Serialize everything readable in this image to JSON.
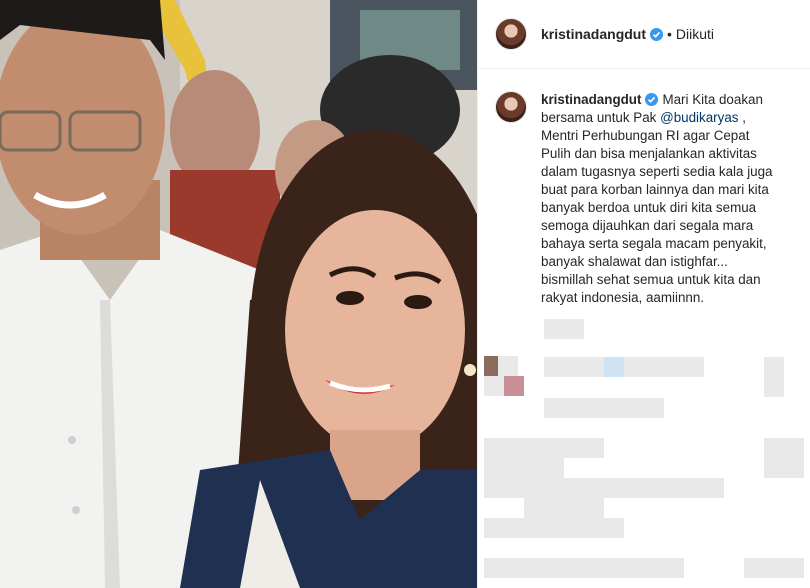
{
  "post": {
    "username": "kristinadangdut",
    "separator": "•",
    "follow_state": "Diikuti"
  },
  "caption": {
    "username": "kristinadangdut",
    "mention": "@budikaryas",
    "lines": [
      "Mari Kita doakan",
      "bersama untuk Pak",
      " ,",
      "Mentri Perhubungan RI agar Cepat",
      "Pulih dan bisa menjalankan aktivitas",
      "dalam tugasnya seperti sedia kala juga",
      "buat para korban lainnya dan mari kita",
      "banyak berdoa untuk diri kita semua",
      "semoga dijauhkan dari segala mara",
      "bahaya serta segala macam penyakit,",
      "banyak shalawat dan istighfar...",
      "bismillah sehat semua untuk kita dan",
      "rakyat indonesia, aamiinnn."
    ]
  },
  "colors": {
    "text": "#262626",
    "mention": "#00376b",
    "verified": "#3897f0",
    "border": "#efefef"
  },
  "icons": {
    "verified": "verified-badge-icon",
    "avatar": "profile-avatar"
  }
}
